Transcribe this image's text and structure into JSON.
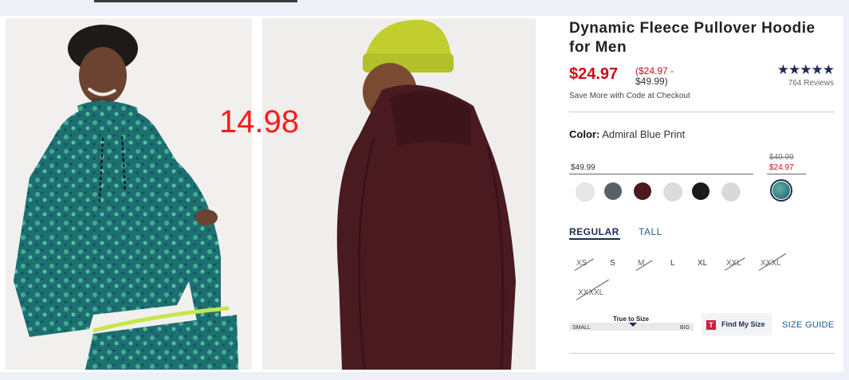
{
  "overlay_note": "14.98",
  "product": {
    "title": "Dynamic Fleece Pullover Hoodie for Men",
    "price": "$24.97",
    "range_sale": "($24.97 -",
    "range_regular": "$49.99)",
    "save_note": "Save More with Code at Checkout",
    "rating_stars": "★★★★★",
    "reviews": "764 Reviews"
  },
  "color": {
    "label": "Color:",
    "value": "Admiral Blue Print",
    "group1_price": "$49.99",
    "group2_old_price": "$49.99",
    "group2_sale_price": "$24.97",
    "swatches": [
      "#e6e6e6",
      "#5a5e66",
      "#4a1a1e",
      "#dcdcdc",
      "#1a1a1a",
      "#d9d9d9",
      "#2a6a7a"
    ]
  },
  "fit_tabs": {
    "regular": "REGULAR",
    "tall": "TALL"
  },
  "sizes": [
    "XS",
    "S",
    "M",
    "L",
    "XL",
    "XXL",
    "XXXL",
    "XXXXL"
  ],
  "fit_meter": {
    "title": "True to Size",
    "small": "SMALL",
    "big": "BIG"
  },
  "find_my_size": {
    "icon_letter": "T",
    "label": "Find My Size"
  },
  "size_guide": "SIZE GUIDE",
  "colors": {
    "sale_red": "#cc0c19",
    "navy": "#1d2b55",
    "link_blue": "#1d5c8c"
  }
}
